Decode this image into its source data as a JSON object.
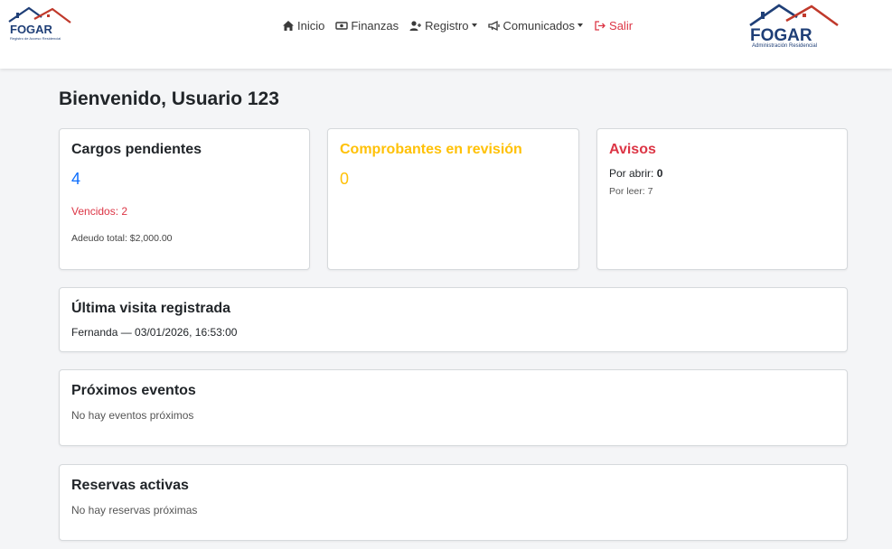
{
  "brand": {
    "small_logo_text": "FOGAR",
    "small_logo_tagline": "Registro de Acceso Residencial",
    "big_logo_text": "FOGAR",
    "big_logo_tagline": "Administración Residencial",
    "logo_blue": "#1f3f77",
    "logo_red": "#c0392b"
  },
  "nav": {
    "items": [
      {
        "label": "Inicio",
        "icon": "home-icon"
      },
      {
        "label": "Finanzas",
        "icon": "money-icon"
      },
      {
        "label": "Registro",
        "icon": "user-plus-icon",
        "dropdown": true
      },
      {
        "label": "Comunicados",
        "icon": "megaphone-icon",
        "dropdown": true
      },
      {
        "label": "Salir",
        "icon": "logout-icon",
        "color": "#dc3545"
      }
    ]
  },
  "welcome": "Bienvenido, Usuario 123",
  "cards": {
    "pending": {
      "title": "Cargos pendientes",
      "count": "4",
      "overdue": "Vencidos: 2",
      "total": "Adeudo total: $2,000.00"
    },
    "review": {
      "title": "Comprobantes en revisión",
      "count": "0"
    },
    "notices": {
      "title": "Avisos",
      "to_open_label": "Por abrir:",
      "to_open_value": "0",
      "to_read": "Por leer: 7"
    },
    "last_visit": {
      "title": "Última visita registrada",
      "text": "Fernanda — 03/01/2026, 16:53:00"
    },
    "events": {
      "title": "Próximos eventos",
      "text": "No hay eventos próximos"
    },
    "reservations": {
      "title": "Reservas activas",
      "text": "No hay reservas próximas"
    }
  },
  "colors": {
    "primary": "#0d6efd",
    "warning": "#ffc107",
    "danger": "#dc3545",
    "background": "#f4f5f7"
  }
}
